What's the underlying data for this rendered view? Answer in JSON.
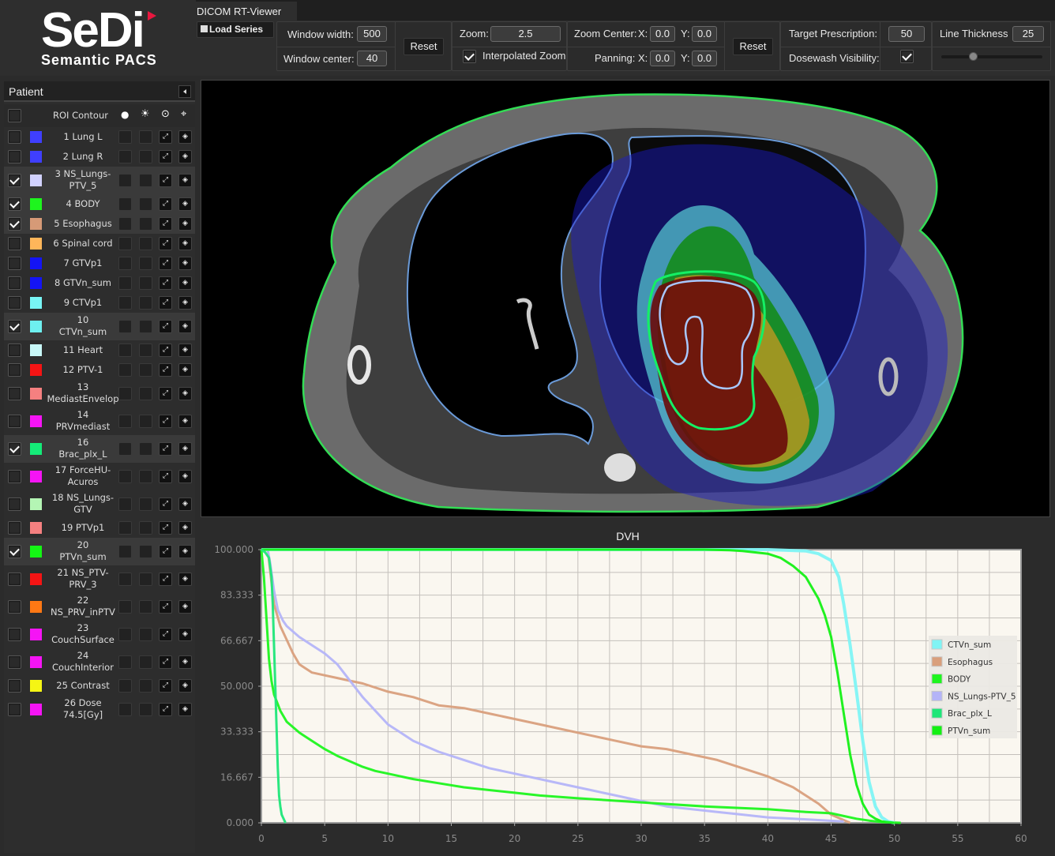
{
  "logo": {
    "brand": "SeDi",
    "subtitle": "Semantic PACS"
  },
  "app_tab": "DICOM RT-Viewer",
  "toolbar": {
    "load_series": "Load Series",
    "window_width_label": "Window width:",
    "window_width": "500",
    "window_center_label": "Window center:",
    "window_center": "40",
    "reset1": "Reset",
    "zoom_label": "Zoom:",
    "zoom": "2.5",
    "interpolated_zoom_label": "Interpolated Zoom",
    "interpolated_zoom_checked": true,
    "zoom_center_label": "Zoom Center:",
    "zoom_center_x_label": "X:",
    "zoom_center_x": "0.0",
    "zoom_center_y_label": "Y:",
    "zoom_center_y": "0.0",
    "panning_label": "Panning:",
    "panning_x_label": "X:",
    "panning_x": "0.0",
    "panning_y_label": "Y:",
    "panning_y": "0.0",
    "reset2": "Reset",
    "target_prescription_label": "Target Prescription:",
    "target_prescription": "50",
    "dosewash_visibility_label": "Dosewash Visibility:",
    "dosewash_visibility_checked": true,
    "line_thickness_label": "Line Thickness",
    "line_thickness": "25",
    "line_thickness_slider_fraction": 0.3
  },
  "sidebar": {
    "title": "Patient",
    "header": {
      "roi_contour": "ROI Contour",
      "col_fill": "●",
      "col_bright": "☀",
      "col_target": "⊙",
      "col_center": "⌖"
    },
    "rois": [
      {
        "label": "1  Lung L",
        "color": "#3f3fff",
        "checked": false
      },
      {
        "label": "2  Lung R",
        "color": "#3f3fff",
        "checked": false
      },
      {
        "label": "3  NS_Lungs-\nPTV_5",
        "color": "#d2d2ff",
        "checked": true
      },
      {
        "label": "4  BODY",
        "color": "#1ef51e",
        "checked": true
      },
      {
        "label": "5  Esophagus",
        "color": "#d69a77",
        "checked": true
      },
      {
        "label": "6  Spinal cord",
        "color": "#ffb65a",
        "checked": false
      },
      {
        "label": "7  GTVp1",
        "color": "#1414f5",
        "checked": false
      },
      {
        "label": "8  GTVn_sum",
        "color": "#1414f5",
        "checked": false
      },
      {
        "label": "9  CTVp1",
        "color": "#78f5f5",
        "checked": false
      },
      {
        "label": "10\nCTVn_sum",
        "color": "#6ef0f0",
        "checked": true
      },
      {
        "label": "11  Heart",
        "color": "#c8f8f8",
        "checked": false
      },
      {
        "label": "12  PTV-1",
        "color": "#f51414",
        "checked": false
      },
      {
        "label": "13\nMediastEnvelop",
        "color": "#f58080",
        "checked": false
      },
      {
        "label": "14\nPRVmediast",
        "color": "#f514f5",
        "checked": false
      },
      {
        "label": "16\nBrac_plx_L",
        "color": "#14eb78",
        "checked": true
      },
      {
        "label": "17  ForceHU-\nAcuros",
        "color": "#f514f5",
        "checked": false
      },
      {
        "label": "18  NS_Lungs-\nGTV",
        "color": "#b4f5b4",
        "checked": false
      },
      {
        "label": "19  PTVp1",
        "color": "#f58080",
        "checked": false
      },
      {
        "label": "20\nPTVn_sum",
        "color": "#14f514",
        "checked": true
      },
      {
        "label": "21  NS_PTV-\nPRV_3",
        "color": "#f51414",
        "checked": false
      },
      {
        "label": "22\nNS_PRV_inPTV",
        "color": "#ff7814",
        "checked": false
      },
      {
        "label": "23\nCouchSurface",
        "color": "#f514f5",
        "checked": false
      },
      {
        "label": "24\nCouchInterior",
        "color": "#f514f5",
        "checked": false
      },
      {
        "label": "25  Contrast",
        "color": "#f5f514",
        "checked": false
      },
      {
        "label": "26  Dose\n74.5[Gy]",
        "color": "#f514f5",
        "checked": false
      }
    ]
  },
  "viewer": {
    "description": "Axial CT slice with RT structure contours and dosewash overlay"
  },
  "chart_data": {
    "type": "line",
    "title": "DVH",
    "xlabel": "",
    "ylabel": "",
    "xlim": [
      0,
      60
    ],
    "ylim": [
      0,
      100
    ],
    "x_ticks": [
      "0",
      "5",
      "10",
      "15",
      "20",
      "25",
      "30",
      "35",
      "40",
      "45",
      "50",
      "55",
      "60"
    ],
    "y_ticks": [
      "0.000",
      "16.667",
      "33.333",
      "50.000",
      "66.667",
      "83.333",
      "100.000"
    ],
    "grid": true,
    "legend_position": "right",
    "series": [
      {
        "name": "CTVn_sum",
        "color": "#80f4f4",
        "x": [
          0,
          30,
          40,
          43,
          44,
          45,
          45.6,
          46,
          46.5,
          47,
          47.5,
          48,
          48.5,
          49,
          49.5,
          50
        ],
        "y": [
          100,
          100,
          100,
          99.5,
          98.5,
          96,
          90,
          80,
          65,
          48,
          30,
          15,
          6,
          2,
          0.5,
          0
        ]
      },
      {
        "name": "Esophagus",
        "color": "#d99f7c",
        "x": [
          0.5,
          0.7,
          1,
          1.5,
          2,
          2.5,
          3,
          4,
          5,
          6,
          7,
          8,
          10,
          12,
          14,
          16,
          18,
          20,
          22,
          24,
          26,
          28,
          30,
          32,
          34,
          36,
          38,
          40,
          41,
          42,
          43,
          44,
          45,
          46,
          46.5
        ],
        "y": [
          100,
          92,
          80,
          72,
          67,
          62,
          58,
          55,
          54,
          53,
          52,
          51,
          48,
          46,
          43,
          42,
          40,
          38,
          36,
          34,
          32,
          30,
          28,
          27,
          25,
          23,
          20,
          17,
          15,
          13,
          10,
          7,
          3,
          1,
          0
        ]
      },
      {
        "name": "BODY",
        "color": "#1ef51e",
        "x": [
          0,
          0.2,
          0.4,
          0.6,
          0.8,
          1,
          1.5,
          2,
          3,
          4,
          5,
          6,
          7,
          8,
          9,
          10,
          12,
          14,
          16,
          18,
          20,
          22,
          25,
          30,
          35,
          40,
          43,
          45,
          46,
          47,
          48,
          49,
          50.5
        ],
        "y": [
          100,
          90,
          75,
          60,
          52,
          47,
          41,
          37,
          33,
          30,
          27,
          24.5,
          22.5,
          20.5,
          19,
          18,
          16,
          14.5,
          13,
          12,
          11,
          10,
          9,
          7.5,
          6,
          5,
          4,
          3.5,
          2.5,
          1.5,
          0.8,
          0.3,
          0
        ]
      },
      {
        "name": "NS_Lungs-PTV_5",
        "color": "#b4b4f8",
        "x": [
          0.5,
          0.7,
          1,
          1.3,
          1.7,
          2,
          3,
          4,
          5,
          6,
          7,
          8,
          9,
          10,
          11,
          12,
          14,
          16,
          18,
          20,
          22,
          24,
          26,
          28,
          30,
          32,
          34,
          36,
          38,
          40,
          42,
          44,
          46
        ],
        "y": [
          100,
          95,
          85,
          78,
          74,
          72,
          68,
          65,
          62,
          58,
          52,
          46,
          41,
          36,
          33,
          30,
          26,
          23,
          20,
          18,
          16,
          14,
          12,
          10,
          8,
          6,
          5,
          4,
          3,
          2,
          1.5,
          1,
          0.5
        ]
      },
      {
        "name": "Brac_plx_L",
        "color": "#1ee678",
        "x": [
          0,
          0.3,
          0.6,
          0.8,
          0.9,
          1,
          1.1,
          1.2,
          1.3,
          1.4,
          1.5,
          1.6,
          1.8,
          1.9
        ],
        "y": [
          100,
          99,
          97,
          90,
          80,
          65,
          50,
          35,
          20,
          10,
          6,
          3,
          1,
          0
        ]
      },
      {
        "name": "PTVn_sum",
        "color": "#14f014",
        "x": [
          0,
          20,
          30,
          35,
          37,
          38,
          39,
          40,
          41,
          42,
          43,
          43.5,
          44,
          44.5,
          45,
          45.5,
          46,
          46.5,
          47,
          47.5,
          48,
          48.5,
          49,
          50
        ],
        "y": [
          100,
          100,
          100,
          100,
          99.8,
          99.5,
          99,
          98.5,
          97,
          94,
          90,
          86,
          82,
          76,
          68,
          55,
          40,
          25,
          14,
          7,
          3,
          1.5,
          0.5,
          0
        ]
      }
    ]
  }
}
